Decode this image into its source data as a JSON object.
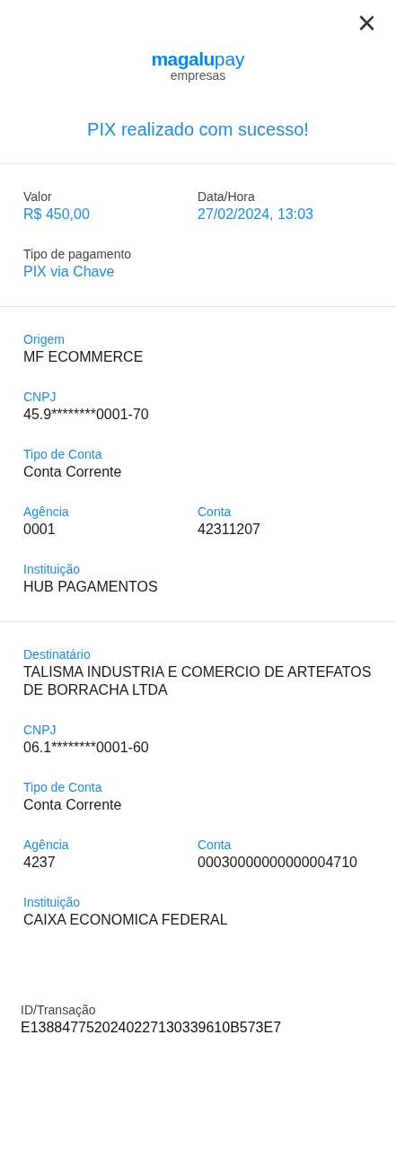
{
  "close_button": {
    "glyph": "×"
  },
  "logo": {
    "brand": "magalu",
    "suffix": "pay",
    "subtitle": "empresas"
  },
  "title": "PIX realizado com sucesso!",
  "sections": [
    {
      "kind": "summary",
      "rows": [
        [
          {
            "label": "Valor",
            "value": "R$ 450,00"
          },
          {
            "label": "Data/Hora",
            "value": "27/02/2024, 13:03"
          }
        ],
        [
          {
            "label": "Tipo de pagamento",
            "value": "PIX via Chave"
          }
        ]
      ]
    },
    {
      "kind": "party",
      "rows": [
        [
          {
            "label": "Origem",
            "value": "MF ECOMMERCE"
          }
        ],
        [
          {
            "label": "CNPJ",
            "value": "45.9********0001-70"
          }
        ],
        [
          {
            "label": "Tipo de Conta",
            "value": "Conta Corrente"
          }
        ],
        [
          {
            "label": "Agência",
            "value": "0001"
          },
          {
            "label": "Conta",
            "value": "42311207"
          }
        ],
        [
          {
            "label": "Instituição",
            "value": "HUB PAGAMENTOS"
          }
        ]
      ]
    },
    {
      "kind": "party",
      "rows": [
        [
          {
            "label": "Destinatário",
            "value": "TALISMA INDUSTRIA E COMERCIO DE ARTEFATOS DE BORRACHA LTDA"
          }
        ],
        [
          {
            "label": "CNPJ",
            "value": "06.1********0001-60"
          }
        ],
        [
          {
            "label": "Tipo de Conta",
            "value": "Conta Corrente"
          }
        ],
        [
          {
            "label": "Agência",
            "value": "4237"
          },
          {
            "label": "Conta",
            "value": "00030000000000004710"
          }
        ],
        [
          {
            "label": "Instituição",
            "value": "CAIXA ECONOMICA FEDERAL"
          }
        ]
      ]
    },
    {
      "kind": "transaction",
      "rows": [
        [
          {
            "label": "ID/Transação",
            "value": "E13884775202402271303396​10B573E7"
          }
        ]
      ]
    }
  ]
}
